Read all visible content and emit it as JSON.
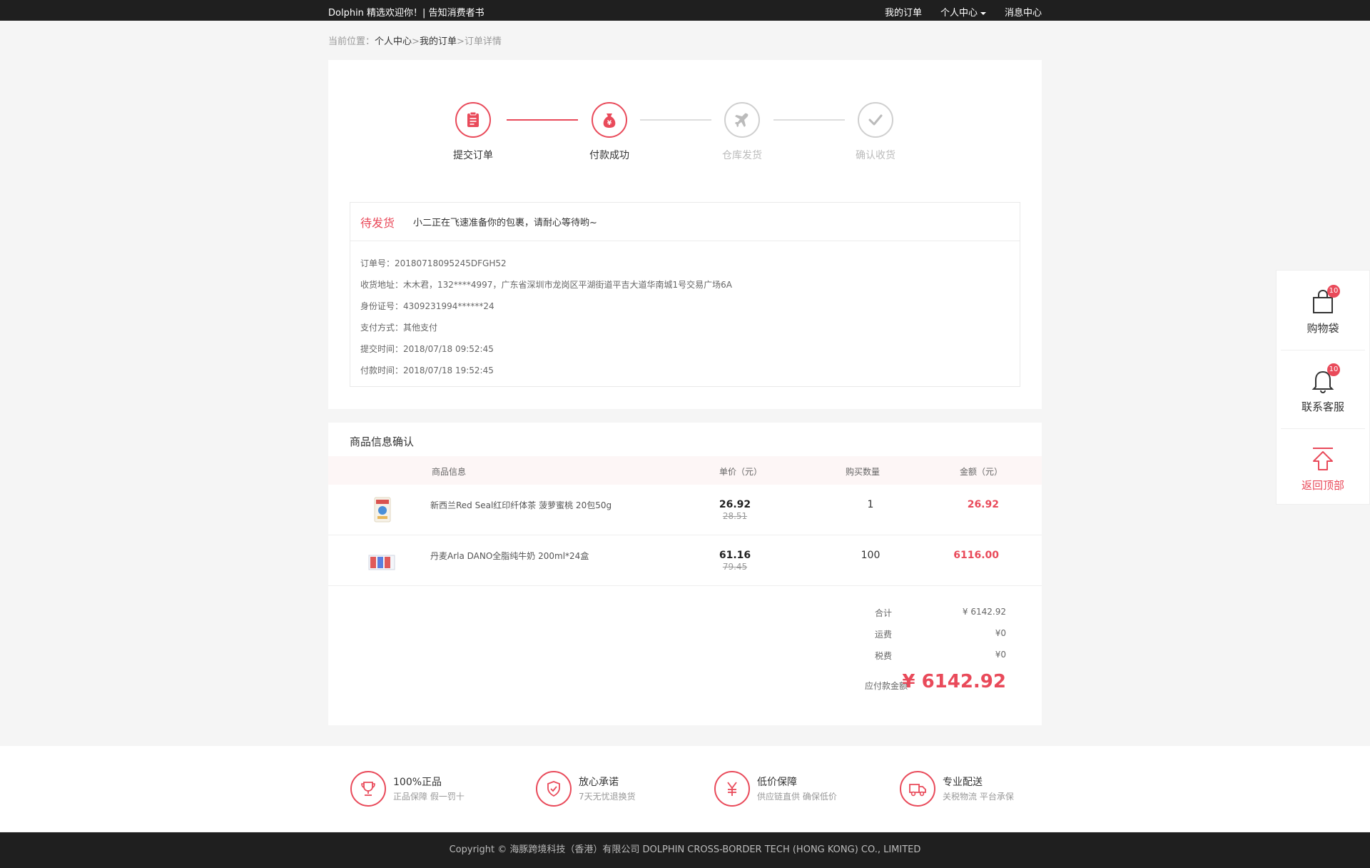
{
  "topbar": {
    "welcome": "Dolphin 精选欢迎你！| 告知消费者书",
    "my_orders": "我的订单",
    "personal_center": "个人中心",
    "messages": "消息中心"
  },
  "breadcrumb": {
    "prefix": "当前位置：",
    "level1": "个人中心",
    "sep": ">",
    "level2": "我的订单",
    "level3": "订单详情"
  },
  "steps": [
    {
      "label": "提交订单",
      "icon": "clipboard-icon",
      "active": true
    },
    {
      "label": "付款成功",
      "icon": "money-bag-icon",
      "active": true
    },
    {
      "label": "仓库发货",
      "icon": "plane-icon",
      "active": false
    },
    {
      "label": "确认收货",
      "icon": "check-icon",
      "active": false
    }
  ],
  "status": {
    "state": "待发货",
    "message": "小二正在飞速准备你的包裹，请耐心等待哟~"
  },
  "order_details": [
    "订单号：20180718095245DFGH52",
    "收货地址：木木君，132****4997，广东省深圳市龙岗区平湖街道平吉大道华南城1号交易广场6A",
    "身份证号：4309231994******24",
    "支付方式：其他支付",
    "提交时间：2018/07/18 09:52:45",
    "付款时间：2018/07/18 19:52:45"
  ],
  "goods": {
    "title": "商品信息确认",
    "headers": {
      "info": "商品信息",
      "price": "单价（元）",
      "qty": "购买数量",
      "amount": "金额（元）"
    },
    "items": [
      {
        "name": "新西兰Red Seal红印纤体茶 菠萝蜜桃 20包50g",
        "price": "26.92",
        "old_price": "28.51",
        "qty": "1",
        "amount": "26.92"
      },
      {
        "name": "丹麦Arla DANO全脂纯牛奶 200ml*24盒",
        "price": "61.16",
        "old_price": "79.45",
        "qty": "100",
        "amount": "6116.00"
      }
    ]
  },
  "totals": {
    "subtotal_label": "合计",
    "subtotal": "¥ 6142.92",
    "shipping_label": "运费",
    "shipping": "¥0",
    "tax_label": "税费",
    "tax": "¥0",
    "payable_label": "应付款金额",
    "payable": "¥ 6142.92"
  },
  "guarantees": [
    {
      "title": "100%正品",
      "subtitle": "正品保障  假一罚十",
      "icon": "trophy-icon"
    },
    {
      "title": "放心承诺",
      "subtitle": "7天无忧退换货",
      "icon": "shield-check-icon"
    },
    {
      "title": "低价保障",
      "subtitle": "供应链直供  确保低价",
      "icon": "yuan-icon"
    },
    {
      "title": "专业配送",
      "subtitle": "关税物流 平台承保",
      "icon": "truck-icon"
    }
  ],
  "footer": {
    "copyright": "Copyright ©  海豚跨境科技（香港）有限公司    DOLPHIN CROSS-BORDER TECH (HONG KONG) CO., LIMITED"
  },
  "side_panel": {
    "cart_label": "购物袋",
    "cart_badge": "10",
    "service_label": "联系客服",
    "service_badge": "10",
    "top_label": "返回顶部"
  },
  "colors": {
    "accent": "#e94a5a",
    "dark_bar": "#1f1f1f",
    "inactive": "#cfcfcf"
  }
}
